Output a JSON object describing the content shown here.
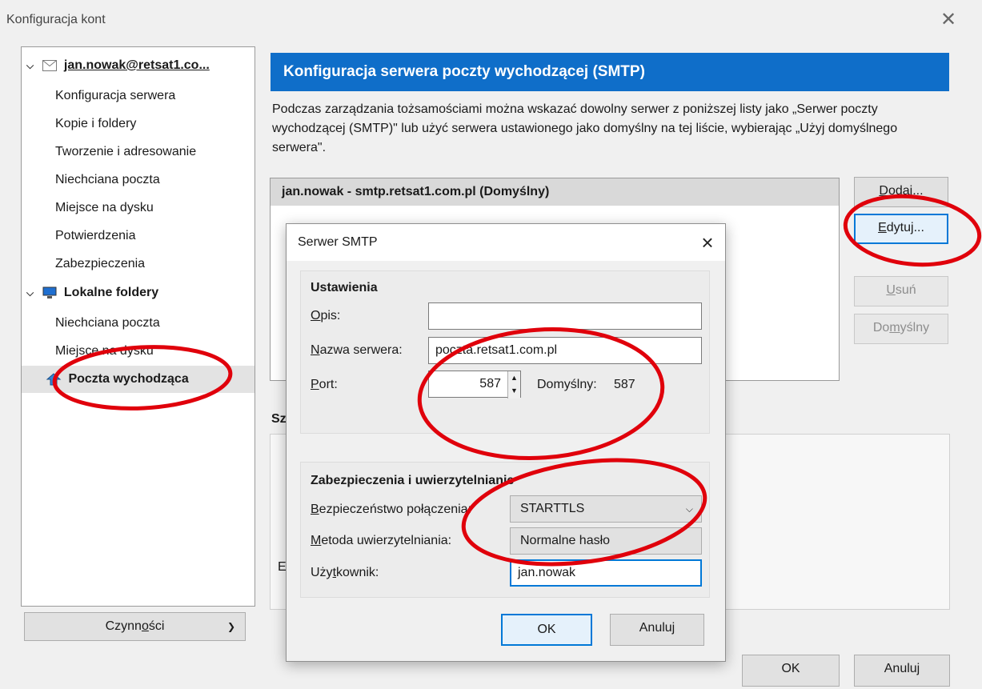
{
  "window": {
    "title": "Konfiguracja kont",
    "close_icon": "close-icon"
  },
  "tree": {
    "account": "jan.nowak@retsat1.co...",
    "account_items": [
      "Konfiguracja serwera",
      "Kopie i foldery",
      "Tworzenie i adresowanie",
      "Niechciana poczta",
      "Miejsce na dysku",
      "Potwierdzenia",
      "Zabezpieczenia"
    ],
    "local": "Lokalne foldery",
    "local_items": [
      "Niechciana poczta",
      "Miejsce na dysku"
    ],
    "outgoing": "Poczta wychodząca"
  },
  "actions": {
    "pre": "Czynn",
    "ul": "o",
    "post": "ści"
  },
  "panel": {
    "title": "Konfiguracja serwera poczty wychodzącej (SMTP)",
    "desc": "Podczas zarządzania tożsamościami można wskazać dowolny serwer z poniższej listy jako „Serwer poczty wychodzącej (SMTP)\" lub użyć serwera ustawionego jako domyślny na tej liście, wybierając „Użyj domyślnego serwera\".",
    "server": "jan.nowak - smtp.retsat1.com.pl (Domyślny)",
    "details_label": "Sz",
    "details_text": "E"
  },
  "buttons": {
    "add": {
      "ul": "D",
      "post": "odaj..."
    },
    "edit": {
      "ul": "E",
      "post": "dytuj..."
    },
    "remove": {
      "pre": "",
      "ul": "U",
      "post": "suń"
    },
    "default": {
      "pre": "Do",
      "ul": "m",
      "post": "yślny"
    },
    "ok": "OK",
    "cancel": "Anuluj"
  },
  "dialog": {
    "title": "Serwer SMTP",
    "settings": {
      "title": "Ustawienia",
      "desc_label": {
        "ul": "O",
        "post": "pis:"
      },
      "desc_value": "",
      "host_label": {
        "ul": "N",
        "post": "azwa serwera:"
      },
      "host_value": "poczta.retsat1.com.pl",
      "port_label": {
        "ul": "P",
        "post": "ort:"
      },
      "port_value": "587",
      "default_label": "Domyślny:",
      "default_value": "587"
    },
    "security": {
      "title": "Zabezpieczenia i uwierzytelnianie",
      "conn_label": {
        "ul": "B",
        "post": "ezpieczeństwo połączenia:"
      },
      "conn_value": "STARTTLS",
      "auth_label": {
        "ul": "M",
        "post": "etoda uwierzytelniania:"
      },
      "auth_value": "Normalne hasło",
      "user_label": {
        "pre": "Uży",
        "ul": "t",
        "post": "kownik:"
      },
      "user_value": "jan.nowak"
    },
    "ok": "OK",
    "cancel": "Anuluj"
  },
  "colors": {
    "accent": "#0f6ec9",
    "annotation": "#e0000b",
    "focus": "#0078d7"
  }
}
